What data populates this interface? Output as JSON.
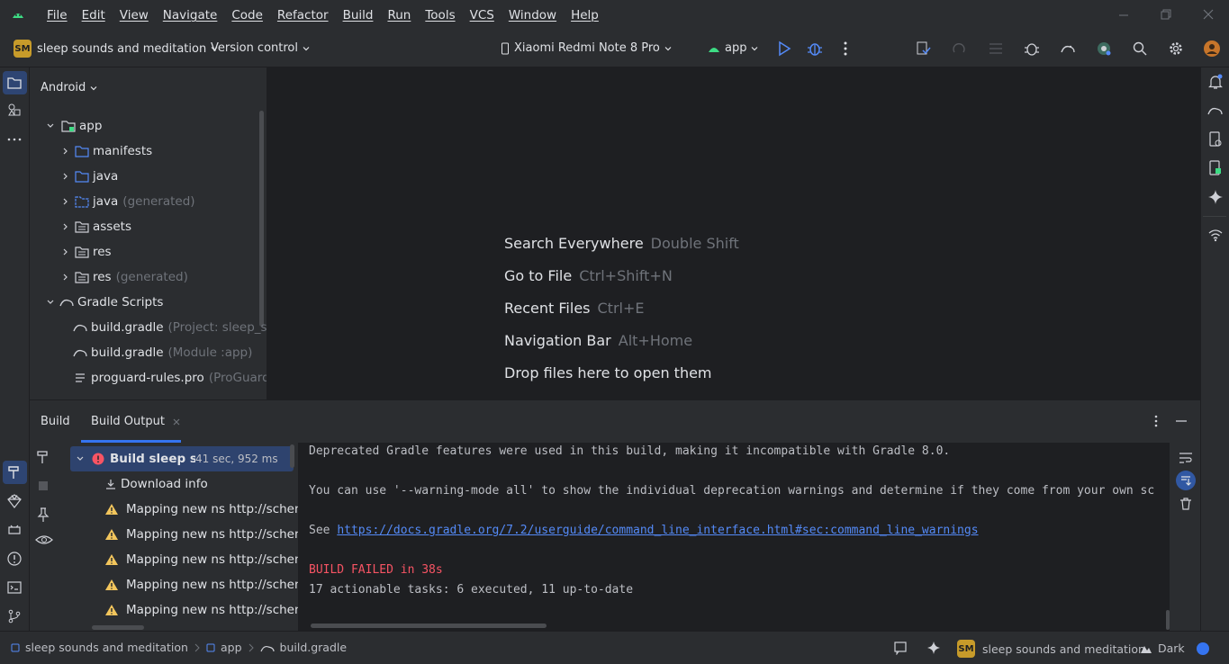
{
  "menubar": {
    "items": [
      "File",
      "Edit",
      "View",
      "Navigate",
      "Code",
      "Refactor",
      "Build",
      "Run",
      "Tools",
      "VCS",
      "Window",
      "Help"
    ]
  },
  "toolbar": {
    "project_badge": "SM",
    "project_name": "sleep sounds and meditation",
    "version_control": "Version control",
    "device": "Xiaomi Redmi Note 8 Pro",
    "run_config": "app"
  },
  "project_panel": {
    "view_mode": "Android",
    "tree": [
      {
        "label": "app",
        "extra": ""
      },
      {
        "label": "manifests",
        "extra": ""
      },
      {
        "label": "java",
        "extra": ""
      },
      {
        "label": "java",
        "extra": "(generated)"
      },
      {
        "label": "assets",
        "extra": ""
      },
      {
        "label": "res",
        "extra": ""
      },
      {
        "label": "res",
        "extra": "(generated)"
      },
      {
        "label": "Gradle Scripts",
        "extra": ""
      },
      {
        "label": "build.gradle",
        "extra": "(Project: sleep_sou"
      },
      {
        "label": "build.gradle",
        "extra": "(Module :app)"
      },
      {
        "label": "proguard-rules.pro",
        "extra": "(ProGuard R"
      }
    ]
  },
  "editor": {
    "hints": [
      {
        "label": "Search Everywhere",
        "key": "Double Shift"
      },
      {
        "label": "Go to File",
        "key": "Ctrl+Shift+N"
      },
      {
        "label": "Recent Files",
        "key": "Ctrl+E"
      },
      {
        "label": "Navigation Bar",
        "key": "Alt+Home"
      },
      {
        "label": "Drop files here to open them",
        "key": ""
      }
    ]
  },
  "build_panel": {
    "tabs": [
      "Build",
      "Build Output"
    ],
    "tree": {
      "root_label": "Build sleep sou",
      "root_time": "41 sec, 952 ms",
      "download": "Download info",
      "warnings": [
        "Mapping new ns http://schema",
        "Mapping new ns http://schema",
        "Mapping new ns http://schema",
        "Mapping new ns http://schema",
        "Mapping new ns http://schema"
      ]
    },
    "console": {
      "line1": "Deprecated Gradle features were used in this build, making it incompatible with Gradle 8.0.",
      "line2": "You can use '--warning-mode all' to show the individual deprecation warnings and determine if they come from your own sc",
      "see_prefix": "See ",
      "link": "https://docs.gradle.org/7.2/userguide/command_line_interface.html#sec:command_line_warnings",
      "failed": "BUILD FAILED in 38s",
      "tasks": "17 actionable tasks: 6 executed, 11 up-to-date"
    }
  },
  "statusbar": {
    "breadcrumbs": [
      "sleep sounds and meditation",
      "app",
      "build.gradle"
    ],
    "project_badge": "SM",
    "project_name": "sleep sounds and meditation",
    "theme": "Dark"
  },
  "colors": {
    "accent": "#3574f0",
    "error": "#f75464",
    "warning": "#f2c55c",
    "link": "#548af7"
  }
}
